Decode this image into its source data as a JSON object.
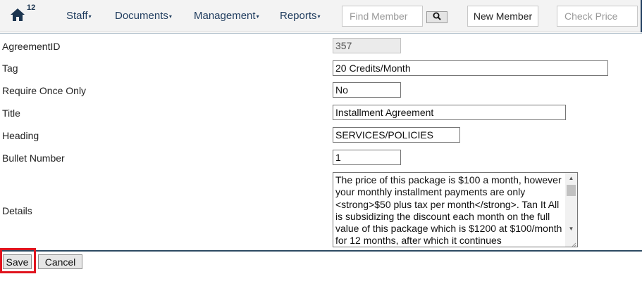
{
  "navbar": {
    "home_icon": "home-icon",
    "notification_count": "12",
    "menus": [
      {
        "label": "Staff"
      },
      {
        "label": "Documents"
      },
      {
        "label": "Management"
      },
      {
        "label": "Reports"
      }
    ],
    "find_member": {
      "value": "",
      "placeholder": "Find Member"
    },
    "search_icon": "search-icon",
    "new_member_label": "New Member",
    "check_price": {
      "value": "",
      "placeholder": "Check Price"
    }
  },
  "form": {
    "agreement_id": {
      "label": "AgreementID",
      "value": "357"
    },
    "tag": {
      "label": "Tag",
      "value": "20 Credits/Month"
    },
    "require_once_only": {
      "label": "Require Once Only",
      "value": "No"
    },
    "title": {
      "label": "Title",
      "value": "Installment Agreement"
    },
    "heading": {
      "label": "Heading",
      "value": "SERVICES/POLICIES"
    },
    "bullet_number": {
      "label": "Bullet Number",
      "value": "1"
    },
    "details": {
      "label": "Details",
      "value": "The price of this package is $100 a month, however your monthly installment payments are only <strong>$50 plus tax per month</strong>. Tan It All is subsidizing the discount each month on the full value of this package which is $1200 at $100/month for 12 months, after which it continues"
    }
  },
  "actions": {
    "save_label": "Save",
    "cancel_label": "Cancel",
    "highlight_color": "#e0141e"
  },
  "colors": {
    "nav_text": "#1f3c5e",
    "nav_background": "#f3f3f3"
  }
}
